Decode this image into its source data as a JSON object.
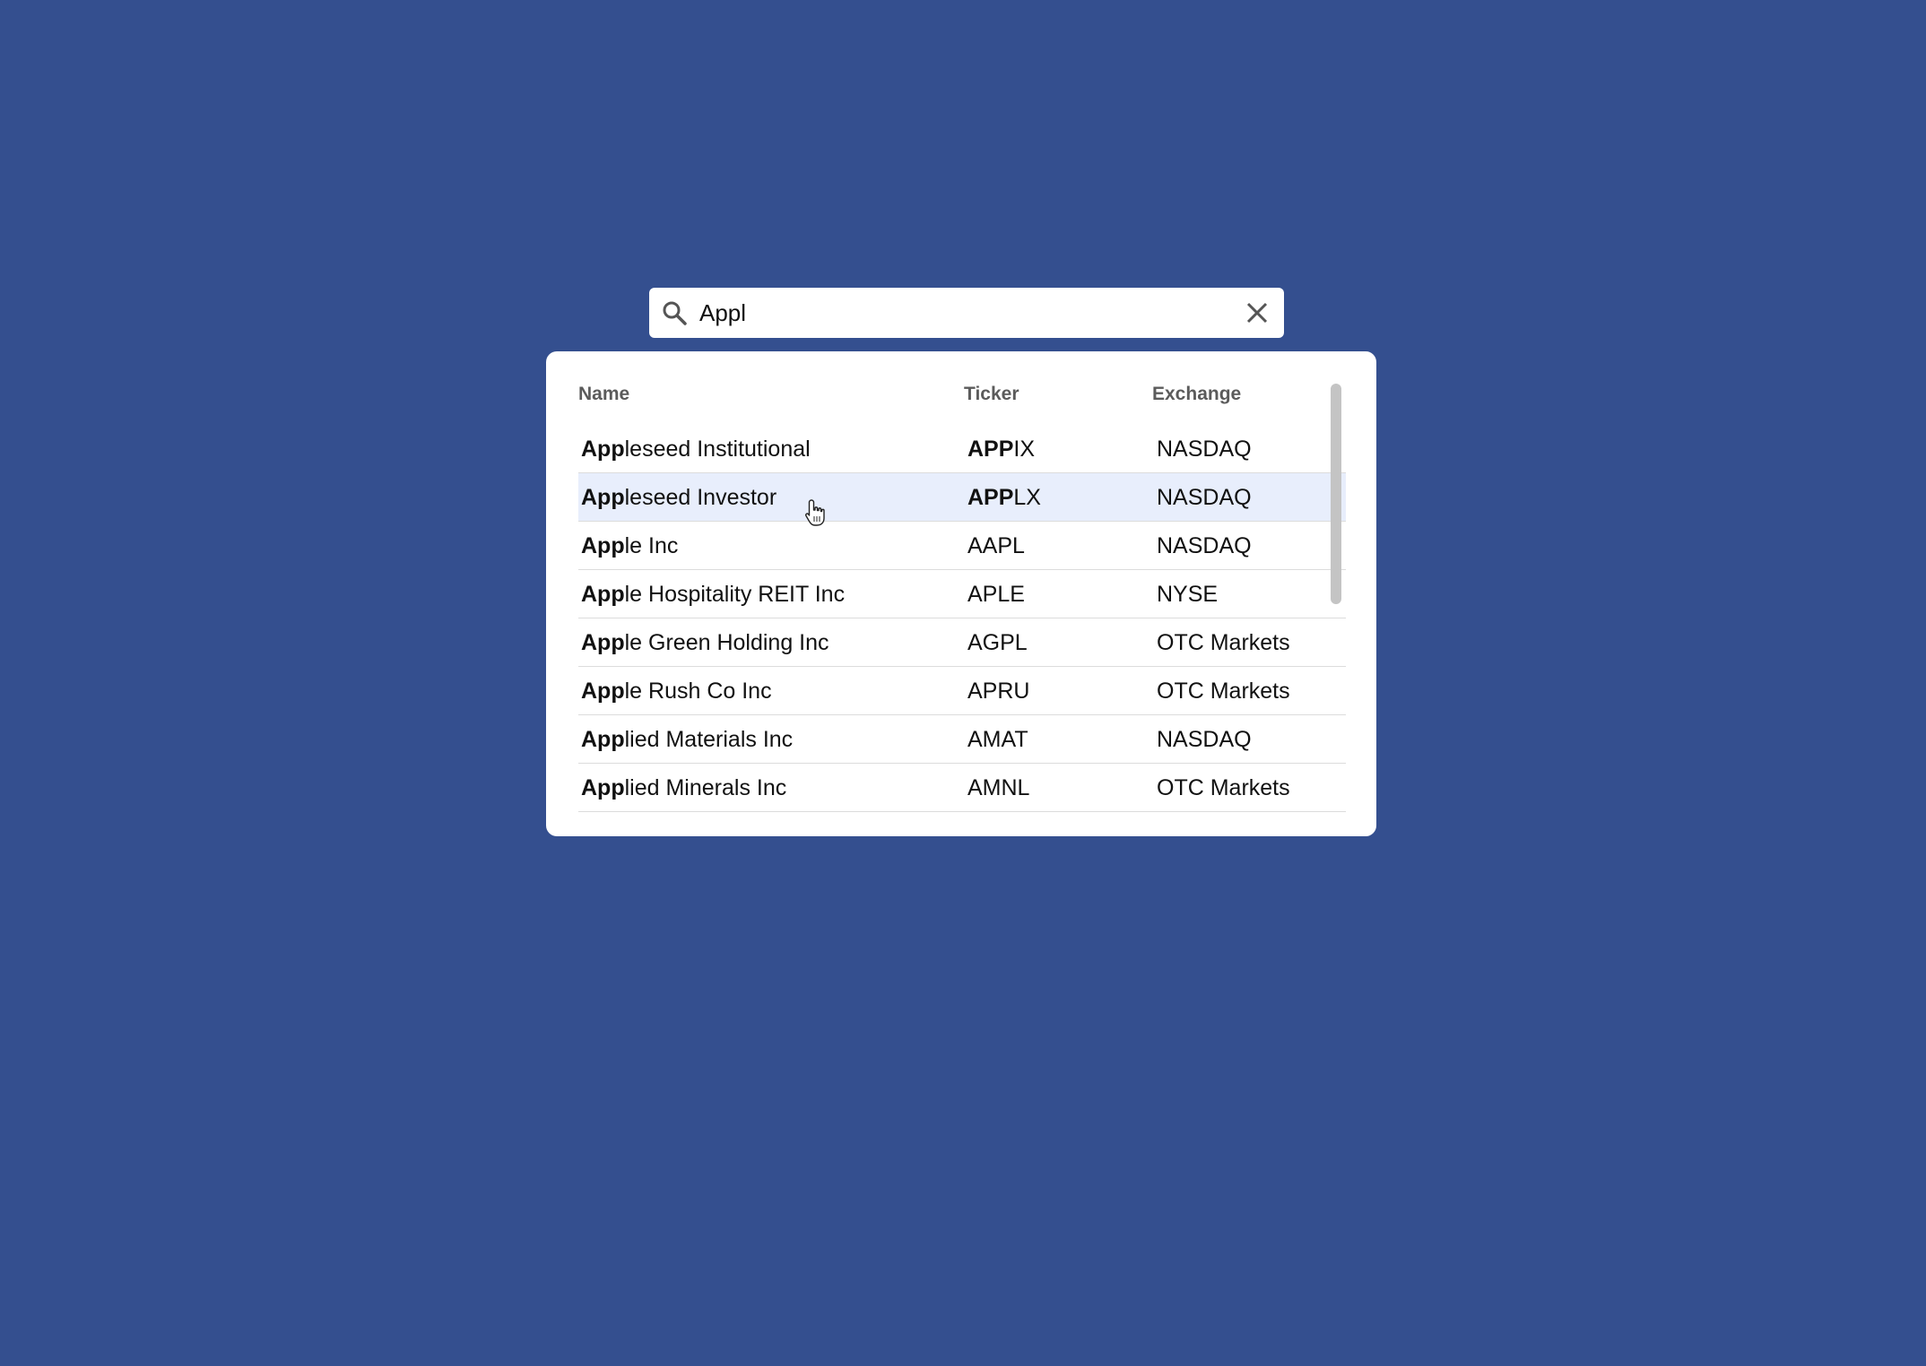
{
  "search": {
    "value": "Appl",
    "query_highlight_name": "App",
    "query_highlight_ticker": "APP"
  },
  "table": {
    "headers": {
      "name": "Name",
      "ticker": "Ticker",
      "exchange": "Exchange"
    },
    "rows": [
      {
        "name_bold": "App",
        "name_rest": "leseed Institutional",
        "ticker_bold": "APP",
        "ticker_rest": "IX",
        "exchange": "NASDAQ"
      },
      {
        "name_bold": "App",
        "name_rest": "leseed Investor",
        "ticker_bold": "APP",
        "ticker_rest": "LX",
        "exchange": "NASDAQ",
        "hover": true
      },
      {
        "name_bold": "App",
        "name_rest": "le Inc",
        "ticker_bold": "",
        "ticker_rest": "AAPL",
        "exchange": "NASDAQ"
      },
      {
        "name_bold": "App",
        "name_rest": "le Hospitality REIT Inc",
        "ticker_bold": "",
        "ticker_rest": "APLE",
        "exchange": "NYSE"
      },
      {
        "name_bold": "App",
        "name_rest": "le Green Holding Inc",
        "ticker_bold": "",
        "ticker_rest": "AGPL",
        "exchange": "OTC Markets"
      },
      {
        "name_bold": "App",
        "name_rest": "le Rush Co Inc",
        "ticker_bold": "",
        "ticker_rest": "APRU",
        "exchange": "OTC Markets"
      },
      {
        "name_bold": "App",
        "name_rest": "lied Materials Inc",
        "ticker_bold": "",
        "ticker_rest": "AMAT",
        "exchange": "NASDAQ"
      },
      {
        "name_bold": "App",
        "name_rest": "lied Minerals Inc",
        "ticker_bold": "",
        "ticker_rest": "AMNL",
        "exchange": "OTC Markets"
      }
    ]
  },
  "colors": {
    "background": "#344f8f",
    "hover_row": "#e8eefc",
    "header_text": "#5b5b5b"
  },
  "icons": {
    "search": "search-icon",
    "clear": "close-icon",
    "cursor": "hand-pointer-icon"
  }
}
